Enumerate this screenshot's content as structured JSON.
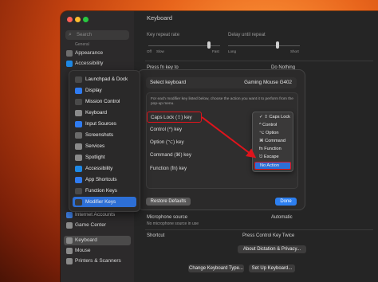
{
  "window": {
    "title": "Keyboard"
  },
  "sidebar": {
    "search_placeholder": "Search",
    "general_label": "General",
    "items": [
      {
        "label": "Appearance",
        "color": "#6e6e6e"
      },
      {
        "label": "Accessibility",
        "color": "#1e88e5"
      },
      {
        "label": "Internet Accounts",
        "color": "#3d7de0"
      },
      {
        "label": "Game Center",
        "color": "#8c8c8c"
      },
      {
        "label": "Keyboard",
        "color": "#8a8a8a"
      },
      {
        "label": "Mouse",
        "color": "#8a8a8a"
      },
      {
        "label": "Printers & Scanners",
        "color": "#8a8a8a"
      }
    ]
  },
  "settings": {
    "key_repeat_rate": "Key repeat rate",
    "delay_until_repeat": "Delay until repeat",
    "off": "Off",
    "slow": "Slow",
    "fast": "Fast",
    "long": "Long",
    "short": "Short",
    "press_fn_key": "Press fn key to",
    "press_fn_value": "Do Nothing",
    "mic_source": "Microphone source",
    "mic_source_value": "Automatic",
    "mic_note": "No microphone source in use",
    "shortcut": "Shortcut",
    "shortcut_value": "Press Control Key Twice",
    "about_dictation_button": "About Dictation & Privacy...",
    "change_keyboard_type_button": "Change Keyboard Type...",
    "set_up_keyboard_button": "Set Up Keyboard..."
  },
  "modal": {
    "select_keyboard_label": "Select keyboard",
    "select_keyboard_value": "Gaming Mouse G402",
    "info_text": "For each modifier key listed below, choose the action you want it to perform from the pop-up menu.",
    "keys": [
      "Caps Lock (⇪) key",
      "Control (^) key",
      "Option (⌥) key",
      "Command (⌘) key",
      "Function (fn) key"
    ],
    "restore_defaults": "Restore Defaults",
    "done": "Done"
  },
  "dropdown": {
    "items": [
      {
        "label": "✓ ⇪ Caps Lock",
        "highlighted": false
      },
      {
        "label": "^ Control",
        "highlighted": false
      },
      {
        "label": "⌥ Option",
        "highlighted": false
      },
      {
        "label": "⌘ Command",
        "highlighted": false
      },
      {
        "label": "fn Function",
        "highlighted": false
      },
      {
        "label": "⎋ Escape",
        "highlighted": false
      },
      {
        "label": "No Action",
        "highlighted": true
      }
    ]
  },
  "overlay": {
    "items": [
      {
        "label": "Launchpad & Dock",
        "color": "#3a3a3a"
      },
      {
        "label": "Display",
        "color": "#2f7bf0"
      },
      {
        "label": "Mission Control",
        "color": "#3a3a3a"
      },
      {
        "label": "Keyboard",
        "color": "#8a8a8a"
      },
      {
        "label": "Input Sources",
        "color": "#2f7bf0"
      },
      {
        "label": "Screenshots",
        "color": "#6b6b6b"
      },
      {
        "label": "Services",
        "color": "#8a8a8a"
      },
      {
        "label": "Spotlight",
        "color": "#8a8a8a"
      },
      {
        "label": "Accessibility",
        "color": "#1e88e5"
      },
      {
        "label": "App Shortcuts",
        "color": "#2f7bf0"
      },
      {
        "label": "Function Keys",
        "color": "#3a3a3a"
      },
      {
        "label": "Modifier Keys",
        "color": "#3a3a3a"
      }
    ],
    "selected_index": 11
  },
  "colors": {
    "accent": "#2d6fd6",
    "annotation_red": "#e0141c"
  }
}
